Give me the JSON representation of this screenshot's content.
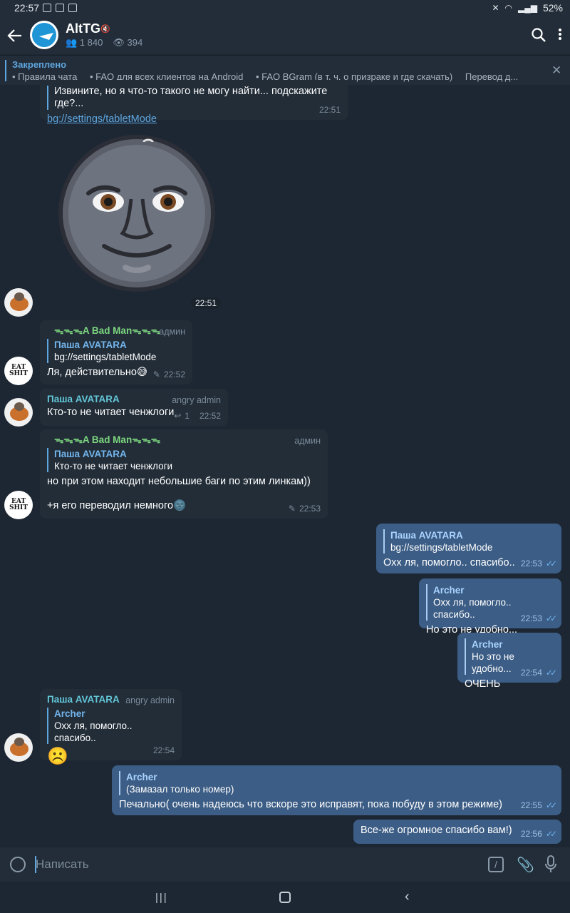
{
  "status_bar": {
    "time": "22:57",
    "battery": "52%"
  },
  "header": {
    "title": "AltTG",
    "members": "1 840",
    "online": "394"
  },
  "pinned": {
    "label": "Закреплено",
    "links": [
      "• Правила чата",
      "• FAQ для всех клиентов на Android",
      "• FAQ BGram (в т. ч. о призраке и где скачать)",
      "Перевод д..."
    ]
  },
  "messages": {
    "m1": {
      "text": "Извините, но я что-то такого не могу найти... подскажите где?...",
      "link": "bg://settings/tabletMode",
      "time": "22:51"
    },
    "sticker": {
      "time": "22:51"
    },
    "m2": {
      "sender": "ᯓᯓᯓA Bad Manᯓᯓᯓ",
      "role": "админ",
      "quote_name": "Паша AVATARA",
      "quote_text": "bg://settings/tabletMode",
      "text": "Ля, действительно😅",
      "time": "22:52"
    },
    "m3": {
      "sender": "Паша AVATARA",
      "role": "angry admin",
      "text": "Кто-то не читает ченжлоги",
      "replies": "1",
      "time": "22:52"
    },
    "m4": {
      "sender": "ᯓᯓᯓA Bad Manᯓᯓᯓ",
      "role": "админ",
      "quote_name": "Паша AVATARA",
      "quote_text": "Кто-то не читает ченжлоги",
      "text1": "но при этом находит небольшие баги по этим линкам))",
      "text2": "+я его переводил немного🌚",
      "time": "22:53"
    },
    "m5": {
      "quote_name": "Паша AVATARA",
      "quote_text": "bg://settings/tabletMode",
      "text": "Охх ля, помогло.. спасибо..",
      "time": "22:53"
    },
    "m6": {
      "quote_name": "Archer",
      "quote_text": "Охх ля, помогло.. спасибо..",
      "text": "Но это не удобно...",
      "time": "22:53"
    },
    "m7": {
      "quote_name": "Archer",
      "quote_text": "Но это не удобно...",
      "text": "ОЧЕНЬ",
      "time": "22:54"
    },
    "m8": {
      "sender": "Паша AVATARA",
      "role": "angry admin",
      "quote_name": "Archer",
      "quote_text": "Охх ля, помогло.. спасибо..",
      "text": "☹️",
      "time": "22:54"
    },
    "m9": {
      "quote_name": "Archer",
      "quote_text": "(Замазал только номер)",
      "text": "Печально( очень надеюсь что вскоре это исправят, пока побуду в этом режиме)",
      "time": "22:55"
    },
    "m10": {
      "text": "Все-же огромное спасибо вам!)",
      "time": "22:56"
    }
  },
  "avatars": {
    "eat_text": "EAT SHIT"
  },
  "input": {
    "placeholder": "Написать"
  }
}
